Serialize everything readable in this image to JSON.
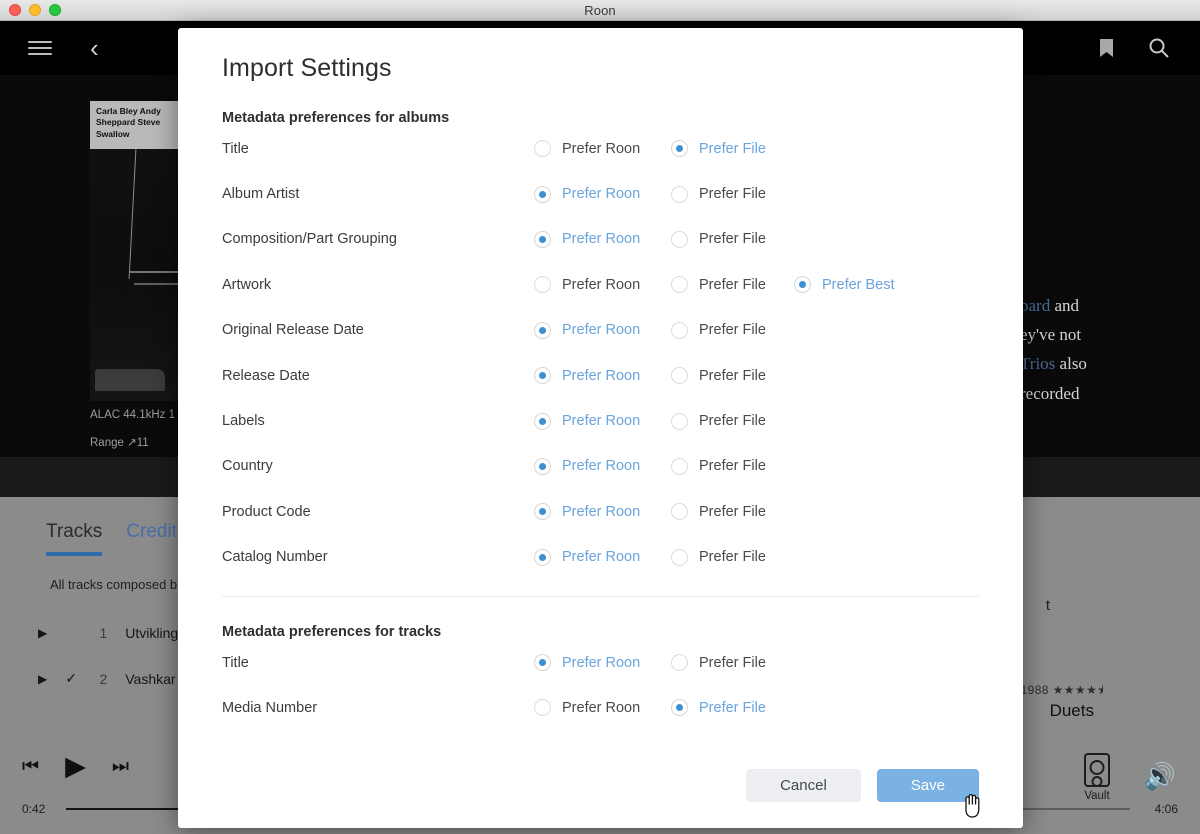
{
  "window": {
    "title": "Roon"
  },
  "app_header": {
    "menu_icon": "hamburger-icon",
    "back_icon": "chevron-left-icon",
    "bookmark_icon": "bookmark-icon",
    "search_icon": "search-icon"
  },
  "album": {
    "art_credits": "Carla Bley\nAndy Sheppard\nSteve Swallow",
    "format_line": "ALAC 44.1kHz 1",
    "range_line": "Range ↗11"
  },
  "bio_fragments": {
    "line1_link": "pard",
    "line1_rest": " and",
    "line2": "ey've not",
    "line3_link": "Trios",
    "line3_rest": " also",
    "line4": "recorded"
  },
  "content": {
    "tabs": [
      {
        "label": "Tracks",
        "active": true
      },
      {
        "label": "Credits",
        "active": false
      }
    ],
    "note": "All tracks composed b",
    "tracks": [
      {
        "play": "▶",
        "check": "",
        "number": "1",
        "title": "Utvikling"
      },
      {
        "play": "▶",
        "check": "✓",
        "number": "2",
        "title": "Vashkar"
      }
    ],
    "right_panel": {
      "fragment": "t",
      "year": "1988",
      "stars": "★★★★⯨",
      "title": "Duets"
    }
  },
  "player": {
    "prev_icon": "skip-previous-icon",
    "play_icon": "play-icon",
    "next_icon": "skip-next-icon",
    "elapsed": "0:42",
    "total": "4:06",
    "zone_label": "Vault",
    "zone_icon": "speaker-icon",
    "volume_icon": "volume-icon"
  },
  "modal": {
    "title": "Import Settings",
    "albums_section_title": "Metadata preferences for albums",
    "tracks_section_title": "Metadata preferences for tracks",
    "album_rows": [
      {
        "label": "Title",
        "choices": [
          {
            "label": "Prefer Roon",
            "selected": false
          },
          {
            "label": "Prefer File",
            "selected": true
          }
        ]
      },
      {
        "label": "Album Artist",
        "choices": [
          {
            "label": "Prefer Roon",
            "selected": true
          },
          {
            "label": "Prefer File",
            "selected": false
          }
        ]
      },
      {
        "label": "Composition/Part Grouping",
        "choices": [
          {
            "label": "Prefer Roon",
            "selected": true
          },
          {
            "label": "Prefer File",
            "selected": false
          }
        ]
      },
      {
        "label": "Artwork",
        "choices": [
          {
            "label": "Prefer Roon",
            "selected": false
          },
          {
            "label": "Prefer File",
            "selected": false
          },
          {
            "label": "Prefer Best",
            "selected": true
          }
        ]
      },
      {
        "label": "Original Release Date",
        "choices": [
          {
            "label": "Prefer Roon",
            "selected": true
          },
          {
            "label": "Prefer File",
            "selected": false
          }
        ]
      },
      {
        "label": "Release Date",
        "choices": [
          {
            "label": "Prefer Roon",
            "selected": true
          },
          {
            "label": "Prefer File",
            "selected": false
          }
        ]
      },
      {
        "label": "Labels",
        "choices": [
          {
            "label": "Prefer Roon",
            "selected": true
          },
          {
            "label": "Prefer File",
            "selected": false
          }
        ]
      },
      {
        "label": "Country",
        "choices": [
          {
            "label": "Prefer Roon",
            "selected": true
          },
          {
            "label": "Prefer File",
            "selected": false
          }
        ]
      },
      {
        "label": "Product Code",
        "choices": [
          {
            "label": "Prefer Roon",
            "selected": true
          },
          {
            "label": "Prefer File",
            "selected": false
          }
        ]
      },
      {
        "label": "Catalog Number",
        "choices": [
          {
            "label": "Prefer Roon",
            "selected": true
          },
          {
            "label": "Prefer File",
            "selected": false
          }
        ]
      }
    ],
    "track_rows": [
      {
        "label": "Title",
        "choices": [
          {
            "label": "Prefer Roon",
            "selected": true
          },
          {
            "label": "Prefer File",
            "selected": false
          }
        ]
      },
      {
        "label": "Media Number",
        "choices": [
          {
            "label": "Prefer Roon",
            "selected": false
          },
          {
            "label": "Prefer File",
            "selected": true
          }
        ]
      }
    ],
    "cancel_label": "Cancel",
    "save_label": "Save"
  },
  "colors": {
    "accent_blue": "#3b8fd4",
    "selected_text": "#6aa3de",
    "save_button": "#7bb2e4",
    "tab_underline": "#2f6bab"
  }
}
